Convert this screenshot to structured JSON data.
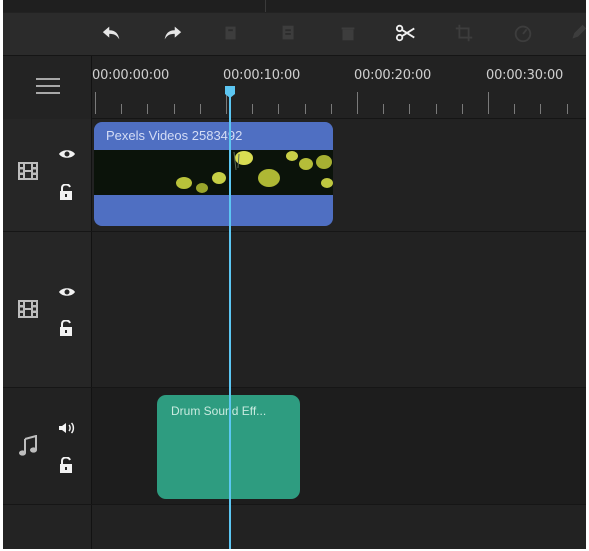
{
  "toolbar": {
    "buttons": [
      {
        "name": "undo-icon",
        "enabled": true
      },
      {
        "name": "redo-icon",
        "enabled": true
      },
      {
        "name": "copy-icon",
        "enabled": false
      },
      {
        "name": "paste-icon",
        "enabled": false
      },
      {
        "name": "delete-icon",
        "enabled": false
      },
      {
        "name": "split-scissors-icon",
        "enabled": true
      },
      {
        "name": "crop-icon",
        "enabled": false
      },
      {
        "name": "speed-icon",
        "enabled": false
      },
      {
        "name": "edit-icon",
        "enabled": false
      }
    ]
  },
  "ruler": {
    "time_labels": [
      "00:00:00:00",
      "00:00:10:00",
      "00:00:20:00",
      "00:00:30:00"
    ]
  },
  "tracks": [
    {
      "type": "video",
      "icon": "film-icon",
      "visibility_icon": "eye-icon",
      "lock_icon": "unlock-icon"
    },
    {
      "type": "video",
      "icon": "film-icon",
      "visibility_icon": "eye-icon",
      "lock_icon": "unlock-icon"
    },
    {
      "type": "audio",
      "icon": "music-note-icon",
      "volume_icon": "speaker-icon",
      "lock_icon": "unlock-icon"
    }
  ],
  "clips": {
    "video": {
      "title": "Pexels Videos 2583492"
    },
    "audio": {
      "title": "Drum Sound Eff..."
    }
  },
  "playhead": {
    "time": "00:00:10:00"
  },
  "colors": {
    "video_clip": "#4f6fc2",
    "audio_clip": "#2e9c80",
    "playhead": "#5cc6f2",
    "background": "#222222"
  }
}
